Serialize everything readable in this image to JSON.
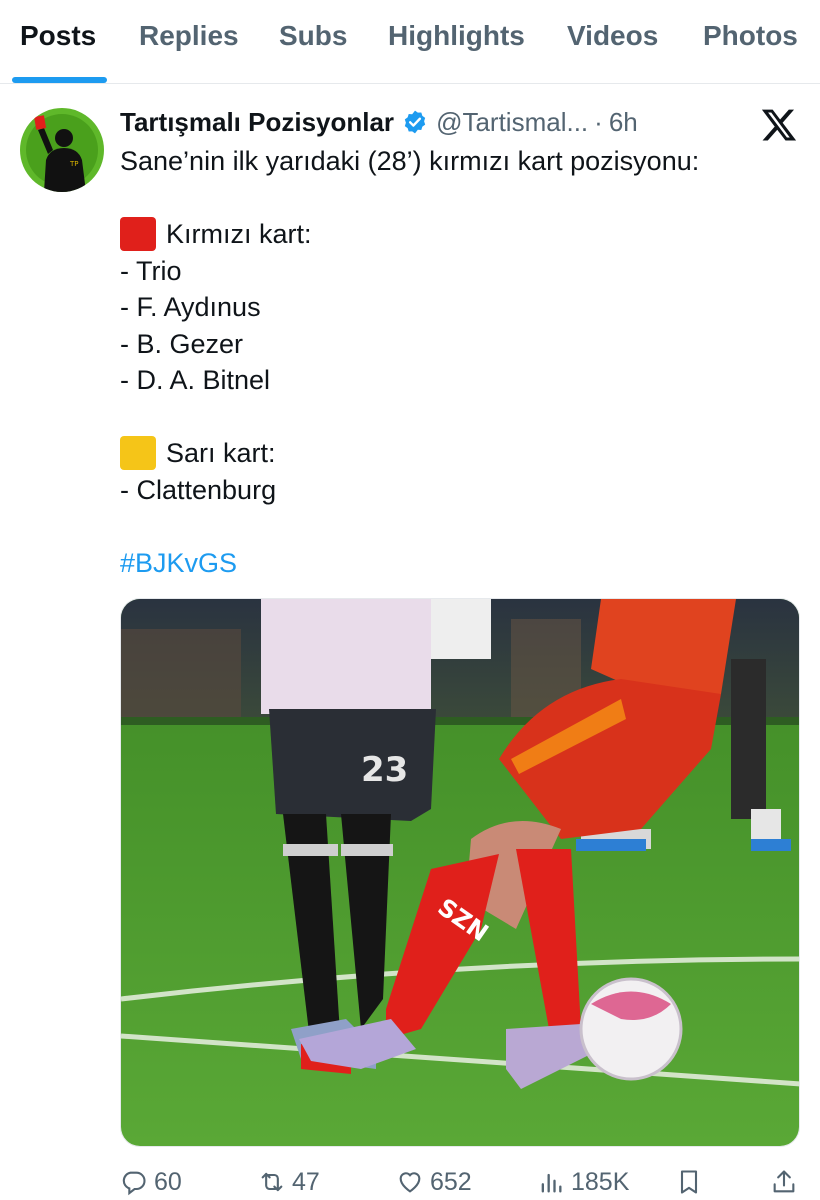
{
  "tabs": [
    {
      "label": "Posts",
      "active": true
    },
    {
      "label": "Replies",
      "active": false
    },
    {
      "label": "Subs",
      "active": false
    },
    {
      "label": "Highlights",
      "active": false
    },
    {
      "label": "Videos",
      "active": false
    },
    {
      "label": "Photos",
      "active": false
    }
  ],
  "post": {
    "author": "Tartışmalı Pozisyonlar",
    "handle": "@Tartismal...",
    "separator": "·",
    "time": "6h",
    "lines": {
      "intro": "Sane’nin ilk yarıdaki (28’) kırmızı kart pozisyonu:",
      "red_heading": "Kırmızı kart:",
      "red_1": "- Trio",
      "red_2": "- F. Aydınus",
      "red_3": "- B. Gezer",
      "red_4": "- D. A. Bitnel",
      "yellow_heading": "Sarı kart:",
      "yellow_1": "- Clattenburg",
      "hashtag": "#BJKvGS"
    },
    "media_jersey_number": "23",
    "media_boot_text": "SZN",
    "avatar_text": "TP"
  },
  "actions": {
    "replies": "60",
    "reposts": "47",
    "likes": "652",
    "views": "185K"
  },
  "colors": {
    "accent": "#1d9bf0",
    "secondary_text": "#536471",
    "pitch_green": "#4f9a2f",
    "red_card": "#e0201b",
    "yellow_card": "#f5c518"
  },
  "icons": [
    "x-logo-icon",
    "verified-badge-icon",
    "reply-icon",
    "repost-icon",
    "like-icon",
    "views-icon",
    "bookmark-icon",
    "share-icon"
  ]
}
